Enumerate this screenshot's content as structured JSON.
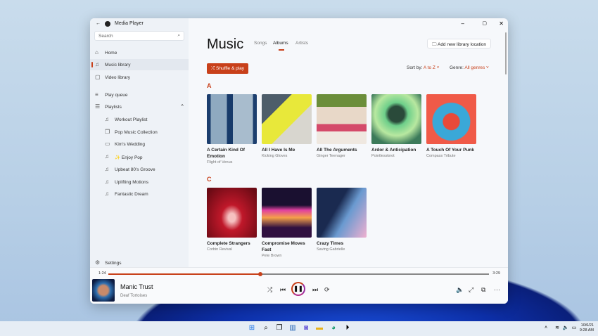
{
  "app": {
    "title": "Media Player"
  },
  "sidebar": {
    "search_placeholder": "Search",
    "items": [
      {
        "label": "Home",
        "icon": "home-icon"
      },
      {
        "label": "Music library",
        "icon": "music-icon"
      },
      {
        "label": "Video library",
        "icon": "video-icon"
      },
      {
        "label": "Play queue",
        "icon": "queue-icon"
      },
      {
        "label": "Playlists",
        "icon": "playlist-icon"
      }
    ],
    "playlists": [
      "Workout Playlist",
      "Pop Music Collection",
      "Kim's Wedding",
      "✨ Enjoy Pop",
      "Upbeat 80's Groove",
      "Uplifting Motions",
      "Fantastic Dream"
    ],
    "settings": "Settings"
  },
  "main": {
    "title": "Music",
    "tabs": [
      "Songs",
      "Albums",
      "Artists"
    ],
    "active_tab": "Albums",
    "add_location": "Add new library location",
    "shuffle": "Shuffle & play",
    "sort_label": "Sort by:",
    "sort_value": "A to Z",
    "genre_label": "Genre:",
    "genre_value": "All genres",
    "sections": [
      {
        "letter": "A",
        "albums": [
          {
            "title": "A Certain Kind Of Emotion",
            "artist": "Flight of Venus"
          },
          {
            "title": "All I Have Is Me",
            "artist": "Kicking Gloves"
          },
          {
            "title": "All The Arguments",
            "artist": "Ginger Teenager"
          },
          {
            "title": "Ardor & Anticipation",
            "artist": "Pointlessknot"
          },
          {
            "title": "A Touch Of Your Punk",
            "artist": "Compass Tribute"
          }
        ]
      },
      {
        "letter": "C",
        "albums": [
          {
            "title": "Complete Strangers",
            "artist": "Corbin Revival"
          },
          {
            "title": "Compromise Moves Fast",
            "artist": "Pete Brown"
          },
          {
            "title": "Crazy Times",
            "artist": "Saving Gabrielle"
          }
        ]
      }
    ]
  },
  "player": {
    "elapsed": "1:24",
    "duration": "3:29",
    "progress": 0.4,
    "track": "Manic Trust",
    "artist": "Deaf Tortoises"
  },
  "taskbar": {
    "date": "10/6/21",
    "time": "9:28 AM"
  },
  "colors": {
    "accent": "#c8401a"
  }
}
